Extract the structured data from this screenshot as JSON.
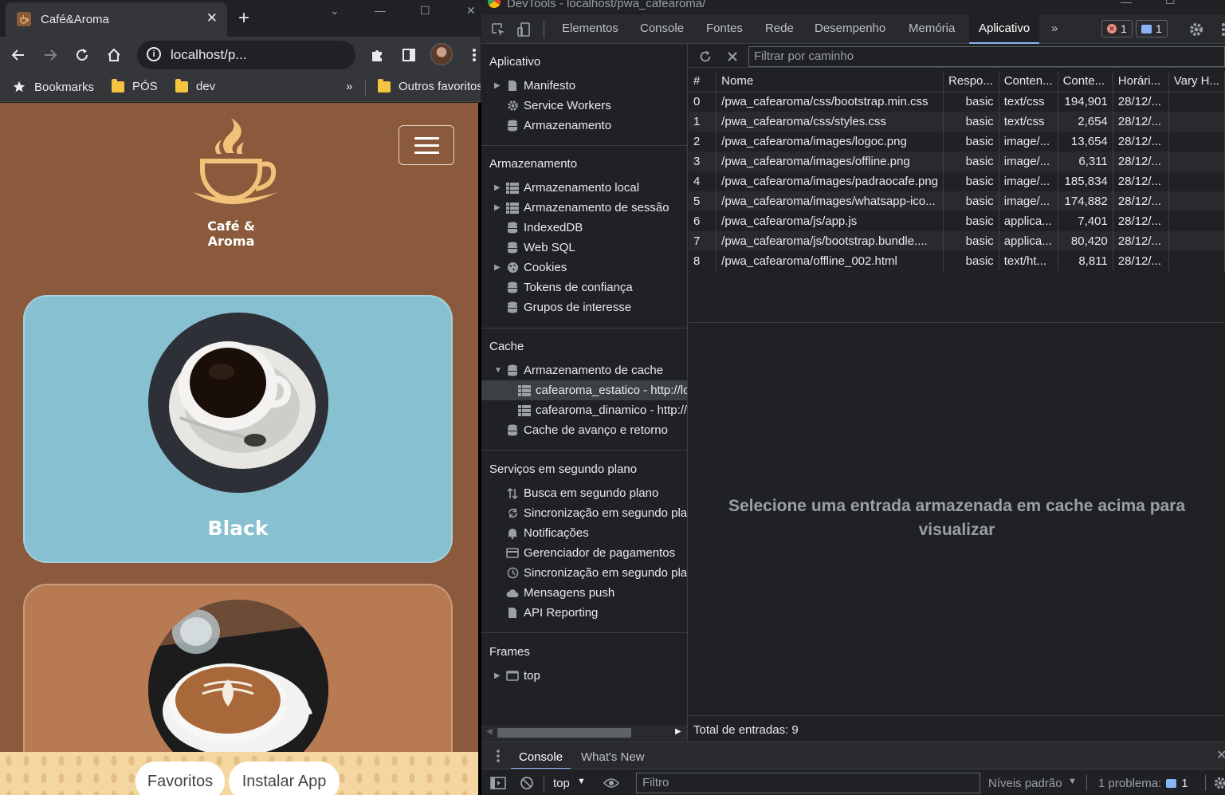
{
  "browser": {
    "tab_title": "Café&Aroma",
    "tab_close": "✕",
    "new_tab": "+",
    "address": "localhost/p...",
    "bookmarks": [
      {
        "label": "Bookmarks",
        "icon": "star-icon"
      },
      {
        "label": "PÓS",
        "icon": "folder-icon"
      },
      {
        "label": "dev",
        "icon": "folder-icon"
      },
      {
        "label": "Outros favoritos",
        "icon": "folder-icon"
      }
    ],
    "bookmarks_overflow": "»"
  },
  "page": {
    "logo_text_line1": "Café &",
    "logo_text_line2": "Aroma",
    "cards": [
      {
        "label": "Black",
        "color": "#87c0d0"
      },
      {
        "label": "",
        "color": "#b87a52"
      }
    ],
    "bottom_buttons": [
      "Favoritos",
      "Instalar App"
    ],
    "background_color": "#8b5a3c"
  },
  "devtools": {
    "title": "DevTools - localhost/pwa_cafearoma/",
    "tabs": [
      "Elementos",
      "Console",
      "Fontes",
      "Rede",
      "Desempenho",
      "Memória",
      "Aplicativo"
    ],
    "active_tab": "Aplicativo",
    "more_tabs": "»",
    "error_count": "1",
    "message_count": "1",
    "sidebar": {
      "sections": [
        {
          "header": "Aplicativo",
          "items": [
            {
              "label": "Manifesto",
              "icon": "file-icon",
              "arrow": "▶"
            },
            {
              "label": "Service Workers",
              "icon": "gear-icon",
              "arrow": ""
            },
            {
              "label": "Armazenamento",
              "icon": "database-icon",
              "arrow": ""
            }
          ]
        },
        {
          "header": "Armazenamento",
          "items": [
            {
              "label": "Armazenamento local",
              "icon": "table-icon",
              "arrow": "▶"
            },
            {
              "label": "Armazenamento de sessão",
              "icon": "table-icon",
              "arrow": "▶"
            },
            {
              "label": "IndexedDB",
              "icon": "database-icon",
              "arrow": ""
            },
            {
              "label": "Web SQL",
              "icon": "database-icon",
              "arrow": ""
            },
            {
              "label": "Cookies",
              "icon": "cookie-icon",
              "arrow": "▶"
            },
            {
              "label": "Tokens de confiança",
              "icon": "database-icon",
              "arrow": ""
            },
            {
              "label": "Grupos de interesse",
              "icon": "database-icon",
              "arrow": ""
            }
          ]
        },
        {
          "header": "Cache",
          "items": [
            {
              "label": "Armazenamento de cache",
              "icon": "database-icon",
              "arrow": "▼"
            },
            {
              "label": "cafearoma_estatico - http://lo",
              "icon": "table-icon",
              "arrow": "",
              "child": true,
              "selected": true
            },
            {
              "label": "cafearoma_dinamico - http://l",
              "icon": "table-icon",
              "arrow": "",
              "child": true
            },
            {
              "label": "Cache de avanço e retorno",
              "icon": "database-icon",
              "arrow": ""
            }
          ]
        },
        {
          "header": "Serviços em segundo plano",
          "items": [
            {
              "label": "Busca em segundo plano",
              "icon": "arrows-icon",
              "arrow": ""
            },
            {
              "label": "Sincronização em segundo plano",
              "icon": "sync-icon",
              "arrow": ""
            },
            {
              "label": "Notificações",
              "icon": "bell-icon",
              "arrow": ""
            },
            {
              "label": "Gerenciador de pagamentos",
              "icon": "card-icon",
              "arrow": ""
            },
            {
              "label": "Sincronização em segundo plano",
              "icon": "clock-icon",
              "arrow": ""
            },
            {
              "label": "Mensagens push",
              "icon": "cloud-icon",
              "arrow": ""
            },
            {
              "label": "API Reporting",
              "icon": "file-icon",
              "arrow": ""
            }
          ]
        },
        {
          "header": "Frames",
          "items": [
            {
              "label": "top",
              "icon": "frame-icon",
              "arrow": "▶"
            }
          ]
        }
      ]
    },
    "filter_placeholder": "Filtrar por caminho",
    "table": {
      "headers": [
        "#",
        "Nome",
        "Respo...",
        "Conten...",
        "Conte...",
        "Horári...",
        "Vary H..."
      ],
      "rows": [
        [
          "0",
          "/pwa_cafearoma/css/bootstrap.min.css",
          "basic",
          "text/css",
          "194,901",
          "28/12/..."
        ],
        [
          "1",
          "/pwa_cafearoma/css/styles.css",
          "basic",
          "text/css",
          "2,654",
          "28/12/..."
        ],
        [
          "2",
          "/pwa_cafearoma/images/logoc.png",
          "basic",
          "image/...",
          "13,654",
          "28/12/..."
        ],
        [
          "3",
          "/pwa_cafearoma/images/offline.png",
          "basic",
          "image/...",
          "6,311",
          "28/12/..."
        ],
        [
          "4",
          "/pwa_cafearoma/images/padraocafe.png",
          "basic",
          "image/...",
          "185,834",
          "28/12/..."
        ],
        [
          "5",
          "/pwa_cafearoma/images/whatsapp-ico...",
          "basic",
          "image/...",
          "174,882",
          "28/12/..."
        ],
        [
          "6",
          "/pwa_cafearoma/js/app.js",
          "basic",
          "applica...",
          "7,401",
          "28/12/..."
        ],
        [
          "7",
          "/pwa_cafearoma/js/bootstrap.bundle....",
          "basic",
          "applica...",
          "80,420",
          "28/12/..."
        ],
        [
          "8",
          "/pwa_cafearoma/offline_002.html",
          "basic",
          "text/ht...",
          "8,811",
          "28/12/..."
        ]
      ]
    },
    "preview_message_line1": "Selecione uma entrada armazenada em cache acima para",
    "preview_message_line2": "visualizar",
    "total_entries": "Total de entradas: 9",
    "drawer_tabs": [
      "Console",
      "What's New"
    ],
    "console": {
      "context": "top",
      "filter_placeholder": "Filtro",
      "levels": "Níveis padrão",
      "problems": "1 problema:",
      "problem_count": "1"
    }
  }
}
